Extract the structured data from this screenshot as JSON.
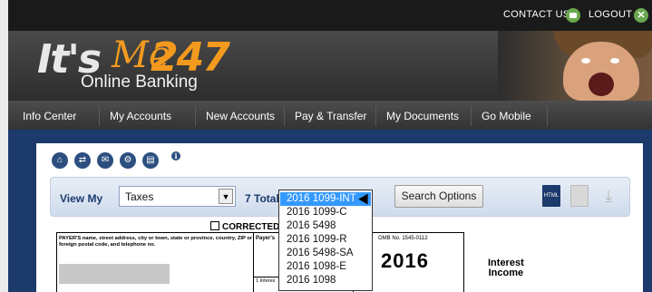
{
  "topbar": {
    "contact": "CONTACT US",
    "logout": "LOGOUT",
    "close_glyph": "✕"
  },
  "logo": {
    "its": "It's",
    "me": "Me",
    "num": "247",
    "sub": "Online Banking"
  },
  "nav": [
    "Info Center",
    "My Accounts",
    "New Accounts",
    "Pay & Transfer",
    "My Documents",
    "Go Mobile"
  ],
  "toolbar_icons": [
    "home-icon",
    "transfer-icon",
    "mail-icon",
    "gear-icon",
    "print-icon",
    "info-icon"
  ],
  "info_glyph": "i",
  "filter": {
    "view_my_label": "View My",
    "selected": "Taxes",
    "total": "7 Total",
    "search_button": "Search Options",
    "html_icon_text": "HTML"
  },
  "dropdown": {
    "items": [
      "2016 1099-INT",
      "2016 1099-C",
      "2016 5498",
      "2016 1099-R",
      "2016 5498-SA",
      "2016 1098-E",
      "2016 1098"
    ],
    "selected_index": 0
  },
  "form": {
    "corrected": "CORRECTED",
    "payer_label": "PAYER'S name, street address, city or town, state or province, country, ZIP or foreign postal code, and telephone no.",
    "payer_tin_label": "Payer's",
    "box1_label": "1 Interes",
    "omb": "OMB No. 1545-0112",
    "year": "2016",
    "title_line1": "Interest",
    "title_line2": "Income"
  },
  "colors": {
    "brand": "#1c3a6b",
    "accent": "#f39a1e",
    "selection": "#3399ff",
    "icon_green": "#6aa84f"
  }
}
